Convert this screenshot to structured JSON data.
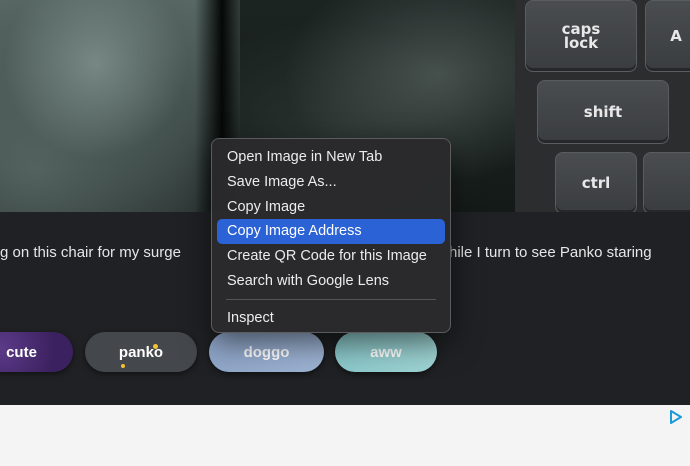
{
  "photo": {
    "keys": [
      "caps lock",
      "A",
      "shift",
      "ctrl"
    ]
  },
  "caption": {
    "text_left": "g on this chair for my surge",
    "text_right": "hile I turn to see Panko staring"
  },
  "tags": [
    {
      "label": "cute"
    },
    {
      "label": "panko"
    },
    {
      "label": "doggo"
    },
    {
      "label": "aww"
    }
  ],
  "context_menu": {
    "items": [
      {
        "label": "Open Image in New Tab"
      },
      {
        "label": "Save Image As..."
      },
      {
        "label": "Copy Image"
      },
      {
        "label": "Copy Image Address"
      },
      {
        "label": "Create QR Code for this Image"
      },
      {
        "label": "Search with Google Lens"
      },
      {
        "label": "Inspect"
      }
    ],
    "highlighted_index": 3,
    "highlight_color": "#2b62d6"
  },
  "ad": {
    "icon": "adchoices-icon",
    "icon_color": "#1a9ad6"
  }
}
